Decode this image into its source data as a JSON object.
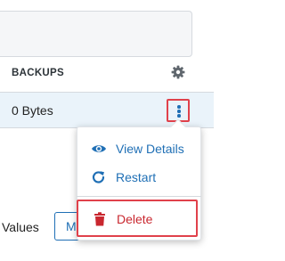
{
  "table": {
    "column_header": "BACKUPS",
    "row_value": "0 Bytes"
  },
  "footer": {
    "values_label": "Values",
    "button_label": "M"
  },
  "menu": {
    "items": [
      {
        "label": "View Details",
        "icon": "eye-icon"
      },
      {
        "label": "Restart",
        "icon": "restart-icon"
      },
      {
        "label": "Delete",
        "icon": "trash-icon"
      }
    ]
  },
  "colors": {
    "accent": "#1f6fb5",
    "danger": "#c9272f",
    "highlight_outline": "#e0414b",
    "selected_row": "#eaf3fa"
  }
}
